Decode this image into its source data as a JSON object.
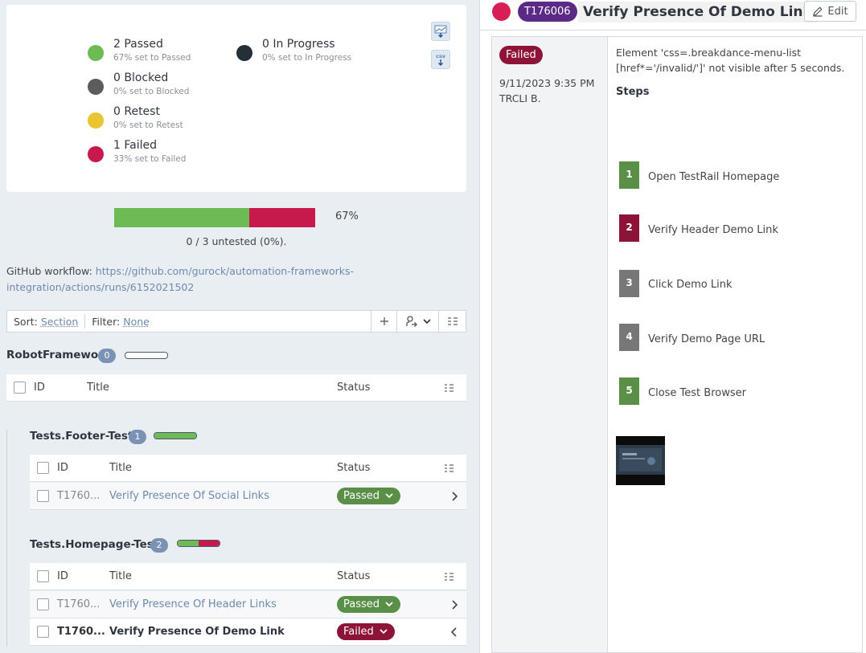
{
  "stats": {
    "passed": {
      "title": "2 Passed",
      "sub": "67% set to Passed",
      "color": "#6cbb55"
    },
    "blocked": {
      "title": "0 Blocked",
      "sub": "0% set to Blocked",
      "color": "#5c5c5c"
    },
    "retest": {
      "title": "0 Retest",
      "sub": "0% set to Retest",
      "color": "#e9c531"
    },
    "failed": {
      "title": "1 Failed",
      "sub": "33% set to Failed",
      "color": "#c8194b"
    },
    "in_progress": {
      "title": "0 In Progress",
      "sub": "0% set to In Progress",
      "color": "#243036"
    }
  },
  "export": {
    "chart_icon": "chart-export-icon",
    "csv_label": "csv"
  },
  "progress": {
    "passed_fraction": 0.67,
    "failed_fraction": 0.33,
    "percent_label": "67%",
    "untested": "0 / 3 untested (0%)."
  },
  "github": {
    "label": "GitHub workflow:",
    "url": "https://github.com/gurock/automation-frameworks-integration/actions/runs/6152021502"
  },
  "toolbar": {
    "sort_label": "Sort:",
    "sort_value": "Section",
    "filter_label": "Filter:",
    "filter_value": "None"
  },
  "table_columns": {
    "id": "ID",
    "title": "Title",
    "status": "Status"
  },
  "sections": {
    "root": {
      "name": "RobotFramework",
      "count": "0"
    },
    "footer": {
      "name": "Tests.Footer-Tests",
      "count": "1",
      "passed_fraction": 1.0
    },
    "homepage": {
      "name": "Tests.Homepage-Tests",
      "count": "2",
      "passed_fraction": 0.5
    }
  },
  "rows": {
    "social": {
      "id": "T1760...",
      "title": "Verify Presence Of Social Links",
      "status": "Passed"
    },
    "header": {
      "id": "T1760...",
      "title": "Verify Presence Of Header Links",
      "status": "Passed"
    },
    "demo": {
      "id": "T1760...",
      "title": "Verify Presence Of Demo Link",
      "status": "Failed"
    }
  },
  "detail": {
    "id": "T176006",
    "title": "Verify Presence Of Demo Link",
    "edit_label": "Edit",
    "status": "Failed",
    "date": "9/11/2023 9:35 PM",
    "user": "TRCLI B.",
    "message": "Element 'css=.breakdance-menu-list [href*='/invalid/']' not visible after 5 seconds.",
    "steps_label": "Steps",
    "steps": [
      {
        "num": "1",
        "text": "Open TestRail Homepage",
        "color": "#5a8f47"
      },
      {
        "num": "2",
        "text": "Verify Header Demo Link",
        "color": "#8e1338"
      },
      {
        "num": "3",
        "text": "Click Demo Link",
        "color": "#777777"
      },
      {
        "num": "4",
        "text": "Verify Demo Page URL",
        "color": "#777777"
      },
      {
        "num": "5",
        "text": "Close Test Browser",
        "color": "#5a8f47"
      }
    ]
  },
  "colors": {
    "passed": "#5a8f47",
    "failed": "#8e1338",
    "badge": "#7a93b5",
    "id_pill": "#5b2a86"
  }
}
